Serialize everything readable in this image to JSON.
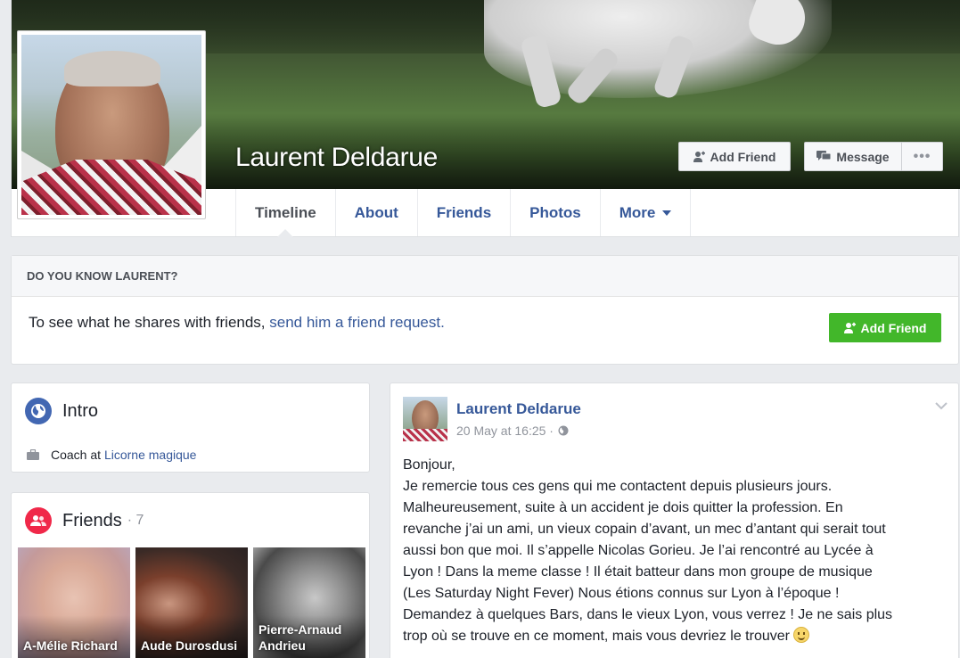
{
  "profile": {
    "name": "Laurent Deldarue",
    "add_friend_label": "Add Friend",
    "message_label": "Message",
    "more_options_label": "•••"
  },
  "tabs": [
    {
      "label": "Timeline",
      "active": true
    },
    {
      "label": "About"
    },
    {
      "label": "Friends"
    },
    {
      "label": "Photos"
    },
    {
      "label": "More"
    }
  ],
  "know": {
    "heading": "DO YOU KNOW LAURENT?",
    "text": "To see what he shares with friends,",
    "link": "send him a friend request.",
    "button": "Add Friend",
    "button_color": "#42b72a"
  },
  "intro": {
    "title": "Intro",
    "job_prefix": "Coach at",
    "job_place": "Licorne magique"
  },
  "friends": {
    "title": "Friends",
    "count": "· 7",
    "items": [
      {
        "name": "A-Mélie Richard"
      },
      {
        "name": "Aude Durosdusi"
      },
      {
        "name": "Pierre-Arnaud Andrieu"
      }
    ]
  },
  "post": {
    "author": "Laurent Deldarue",
    "time": "20 May at 16:25 ·",
    "lines": [
      "Bonjour,",
      "Je remercie tous ces gens qui me contactent depuis plusieurs jours.",
      "Malheureusement, suite à un accident je dois quitter la profession. En",
      "revanche j’ai un ami, un vieux copain d’avant, un mec d’antant qui serait tout",
      "aussi bon que moi. Il s’appelle Nicolas Gorieu. Je l’ai rencontré au Lycée à",
      "Lyon ! Dans la meme classe ! Il était batteur dans mon groupe de musique",
      "(Les Saturday Night Fever) Nous étions connus sur Lyon à l’époque !",
      "Demandez à quelques Bars, dans le vieux Lyon, vous verrez ! Je ne sais plus",
      "trop où se trouve en ce moment, mais vous devriez le trouver"
    ]
  },
  "colors": {
    "link": "#365899",
    "green": "#42b72a",
    "background": "#e9ebee"
  }
}
